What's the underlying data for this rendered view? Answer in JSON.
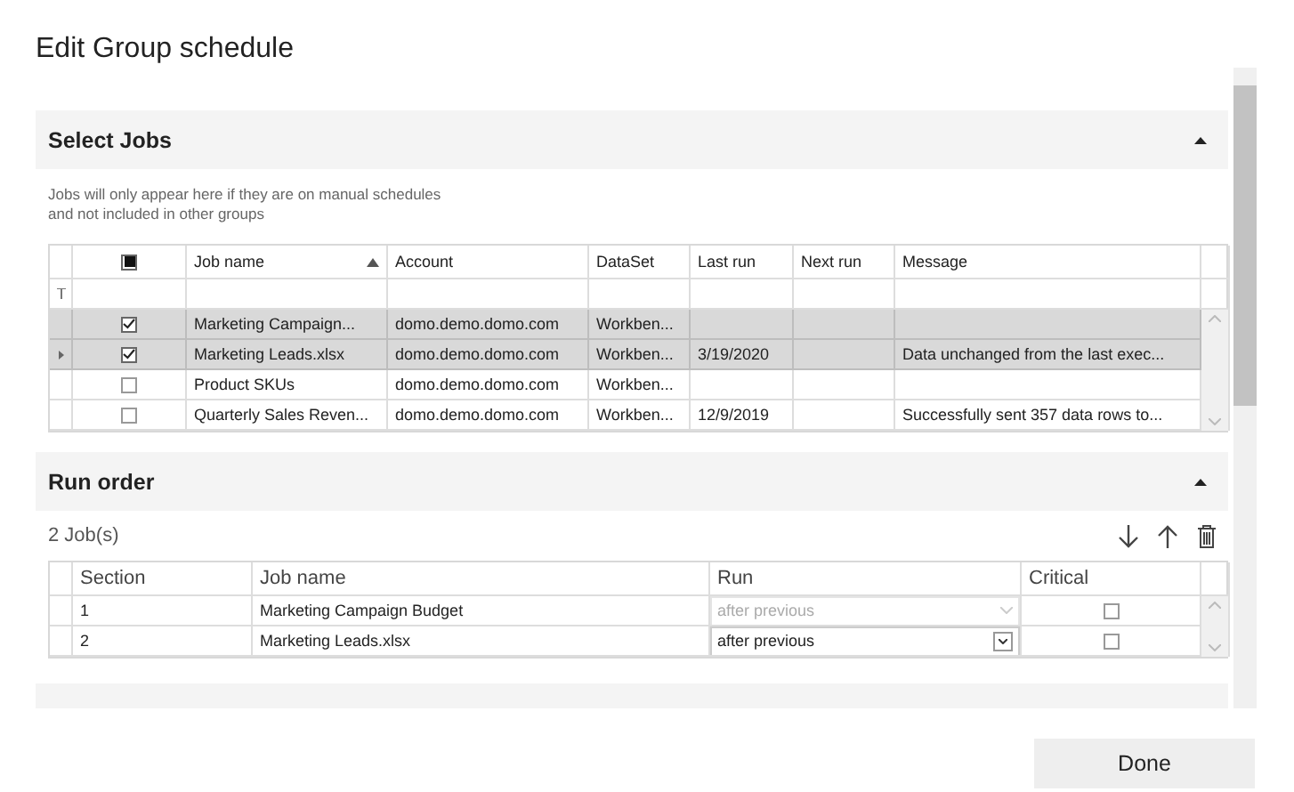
{
  "window": {
    "title": "Edit Group schedule"
  },
  "select_jobs": {
    "title": "Select Jobs",
    "expanded": true,
    "note": "Jobs will only appear here if they are on manual schedules and not included in other groups",
    "header_checkbox_indeterminate": true,
    "columns": [
      {
        "label": "Job name",
        "sorted_ascending": true
      },
      {
        "label": "Account",
        "sorted_ascending": false
      },
      {
        "label": "DataSet",
        "sorted_ascending": false
      },
      {
        "label": "Last run",
        "sorted_ascending": false
      },
      {
        "label": "Next run",
        "sorted_ascending": false
      },
      {
        "label": "Message",
        "sorted_ascending": false
      }
    ],
    "rows": [
      {
        "selected": true,
        "current": false,
        "checked": true,
        "cells": [
          "Marketing Campaign...",
          "domo.demo.domo.com",
          "Workben...",
          "",
          "",
          ""
        ]
      },
      {
        "selected": true,
        "current": true,
        "checked": true,
        "cells": [
          "Marketing Leads.xlsx",
          "domo.demo.domo.com",
          "Workben...",
          "3/19/2020",
          "",
          "Data unchanged from the last exec..."
        ]
      },
      {
        "selected": false,
        "current": false,
        "checked": false,
        "cells": [
          "Product SKUs",
          "domo.demo.domo.com",
          "Workben...",
          "",
          "",
          ""
        ]
      },
      {
        "selected": false,
        "current": false,
        "checked": false,
        "cells": [
          "Quarterly Sales Reven...",
          "domo.demo.domo.com",
          "Workben...",
          "12/9/2019",
          "",
          "Successfully sent 357 data rows to..."
        ]
      }
    ]
  },
  "run_order": {
    "title": "Run order",
    "expanded": true,
    "count": "2 Job(s)",
    "columns": [
      "Section",
      "Job name",
      "Run",
      "Critical"
    ],
    "rows": [
      {
        "section": "1",
        "job_name": "Marketing Campaign Budget",
        "run": "after previous",
        "run_disabled": true,
        "critical": false
      },
      {
        "section": "2",
        "job_name": "Marketing Leads.xlsx",
        "run": "after previous",
        "run_disabled": false,
        "critical": false
      }
    ]
  },
  "buttons": [
    "Done"
  ]
}
